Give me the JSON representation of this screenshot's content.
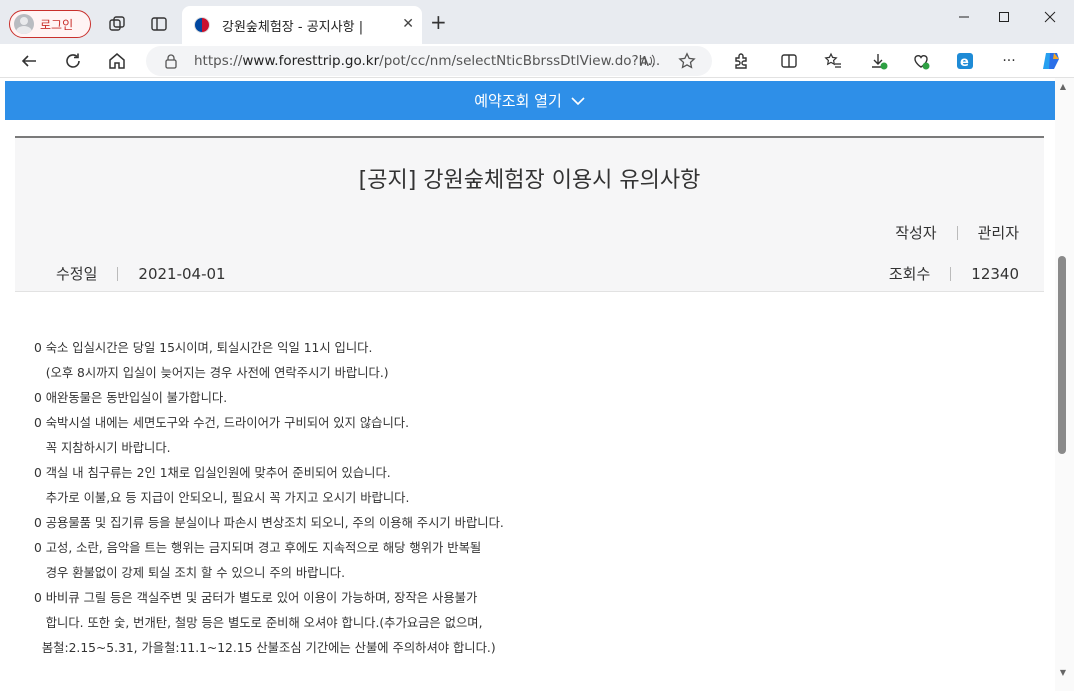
{
  "browser": {
    "profile_label": "로그인",
    "tab_title": "강원숲체험장 - 공지사항 |",
    "url_prefix": "https://",
    "url_host": "www.foresttrip.go.kr",
    "url_path": "/pot/cc/nm/selectNticBbrssDtlView.do?h...",
    "read_aloud_label": "A̅"
  },
  "page": {
    "reserve_toggle_label": "예약조회 열기",
    "notice": {
      "title": "[공지] 강원숲체험장 이용시 유의사항",
      "author_label": "작성자",
      "author_value": "관리자",
      "modified_label": "수정일",
      "modified_value": "2021-04-01",
      "views_label": "조회수",
      "views_value": "12340",
      "body_lines": [
        "0 숙소 입실시간은 당일 15시이며, 퇴실시간은 익일 11시 입니다.",
        "   (오후 8시까지 입실이 늦어지는 경우 사전에 연락주시기 바랍니다.)",
        "0 애완동물은 동반입실이 불가합니다.",
        "0 숙박시설 내에는 세면도구와 수건, 드라이어가 구비되어 있지 않습니다.",
        "   꼭 지참하시기 바랍니다.",
        "0 객실 내 침구류는 2인 1채로 입실인원에 맞추어 준비되어 있습니다.",
        "   추가로 이불,요 등 지급이 안되오니, 필요시 꼭 가지고 오시기 바랍니다.",
        "0 공용물품 및 집기류 등을 분실이나 파손시 변상조치 되오니, 주의 이용해 주시기 바랍니다.",
        "0 고성, 소란, 음악을 트는 행위는 금지되며 경고 후에도 지속적으로 해당 행위가 반복될",
        "   경우 환불없이 강제 퇴실 조치 할 수 있으니 주의 바랍니다.",
        "0 바비큐 그릴 등은 객실주변 및 굼터가 별도로 있어 이용이 가능하며, 장작은 사용불가",
        "   합니다. 또한 숯, 번개탄, 철망 등은 별도로 준비해 오셔야 합니다.(추가요금은 없으며,",
        "  봄철:2.15~5.31, 가을철:11.1~12.15 산불조심 기간에는 산불에 주의하셔야 합니다.)"
      ]
    }
  },
  "colors": {
    "accent_blue": "#2e8fe8",
    "profile_red": "#c9302c"
  },
  "icons": [
    "avatar-icon",
    "workspaces-icon",
    "tab-actions-icon",
    "favicon-icon",
    "close-icon",
    "plus-icon",
    "minimize-icon",
    "maximize-icon",
    "back-icon",
    "refresh-icon",
    "home-icon",
    "lock-icon",
    "read-aloud-icon",
    "favorite-icon",
    "extensions-icon",
    "split-screen-icon",
    "favorites-bar-icon",
    "downloads-icon",
    "health-icon",
    "edge-icon",
    "more-icon",
    "copilot-icon",
    "chevron-down-icon"
  ]
}
